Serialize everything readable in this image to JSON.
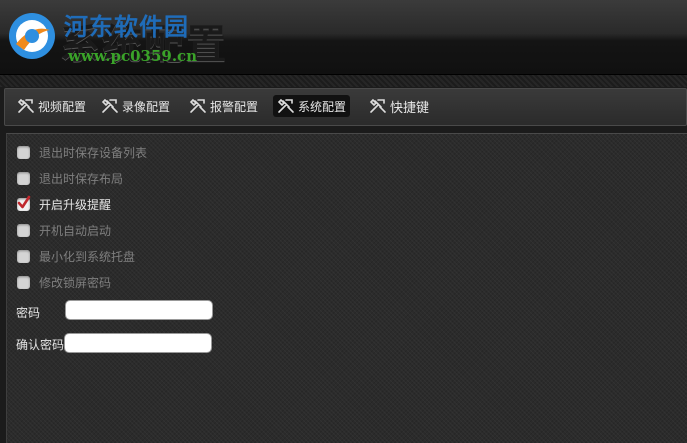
{
  "window": {
    "title": "系统配置"
  },
  "watermark": {
    "site_name": "河东软件园",
    "url": "www.pc0359.cn"
  },
  "tabs": [
    {
      "label": "视频配置",
      "icon": "tools-icon",
      "active": false
    },
    {
      "label": "录像配置",
      "icon": "tools-icon",
      "active": false
    },
    {
      "label": "报警配置",
      "icon": "tools-icon",
      "active": false
    },
    {
      "label": "系统配置",
      "icon": "tools-icon",
      "active": true
    },
    {
      "label": "快捷键",
      "icon": "tools-icon",
      "active": false
    }
  ],
  "options": [
    {
      "label": "退出时保存设备列表",
      "checked": false,
      "enabled": false
    },
    {
      "label": "退出时保存布局",
      "checked": false,
      "enabled": false
    },
    {
      "label": "开启升级提醒",
      "checked": true,
      "enabled": true
    },
    {
      "label": "开机自动启动",
      "checked": false,
      "enabled": false
    },
    {
      "label": "最小化到系统托盘",
      "checked": false,
      "enabled": false
    },
    {
      "label": "修改锁屏密码",
      "checked": false,
      "enabled": false
    }
  ],
  "fields": {
    "password": {
      "label": "密码",
      "value": ""
    },
    "confirm_password": {
      "label": "确认密码",
      "value": ""
    }
  },
  "colors": {
    "check_mark": "#c0282d",
    "watermark_blue": "#1e73c8",
    "watermark_green": "#3aa329"
  }
}
